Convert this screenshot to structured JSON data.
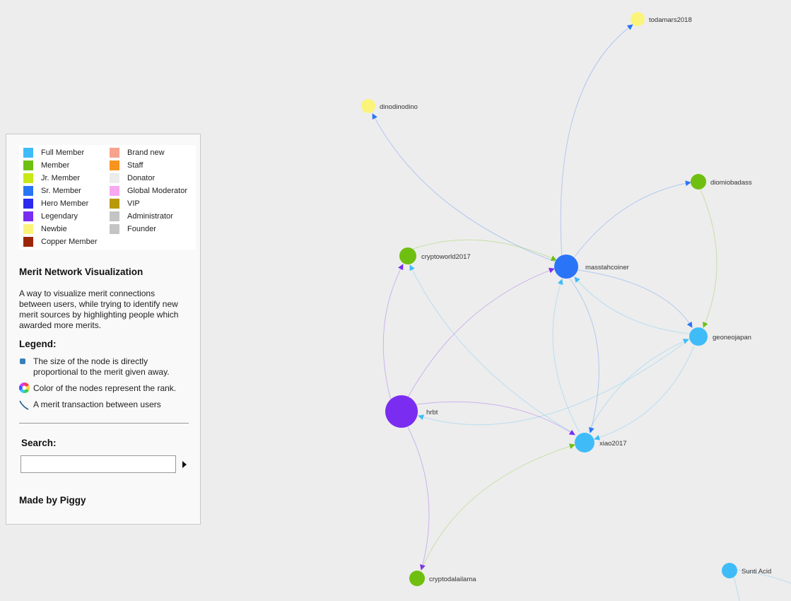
{
  "ranks_left": [
    {
      "name": "Full Member",
      "color": "#3fbcf8"
    },
    {
      "name": "Member",
      "color": "#6fbf10"
    },
    {
      "name": "Jr. Member",
      "color": "#c9e818"
    },
    {
      "name": "Sr. Member",
      "color": "#2a74f8"
    },
    {
      "name": "Hero Member",
      "color": "#2b2bf0"
    },
    {
      "name": "Legendary",
      "color": "#7a2df0"
    },
    {
      "name": "Newbie",
      "color": "#fbf47a"
    },
    {
      "name": "Copper Member",
      "color": "#9c2708"
    }
  ],
  "ranks_right": [
    {
      "name": "Brand new",
      "color": "#f7a28f"
    },
    {
      "name": "Staff",
      "color": "#f7941e"
    },
    {
      "name": "Donator",
      "color": "#ececec"
    },
    {
      "name": "Global Moderator",
      "color": "#f7a8f0"
    },
    {
      "name": "VIP",
      "color": "#b8990a"
    },
    {
      "name": "Administrator",
      "color": "#c4c4c4"
    },
    {
      "name": "Founder",
      "color": "#c4c4c4"
    }
  ],
  "panel": {
    "title": "Merit Network Visualization",
    "description": "A way to visualize merit connections between users, while trying to identify new merit sources by highlighting people which awarded more merits.",
    "legend_heading": "Legend:",
    "legend_size": "The size of the node is directly proportional to the merit given away.",
    "legend_color": "Color of the nodes represent the rank.",
    "legend_edge": "A merit transaction between users",
    "search_heading": "Search:",
    "search_value": "",
    "credit": "Made by Piggy"
  },
  "graph": {
    "nodes": [
      {
        "id": "todamars2018",
        "label": "todamars2018",
        "rank": "Newbie",
        "color": "#fbf47a"
      },
      {
        "id": "dinodinodino",
        "label": "dinodinodino",
        "rank": "Newbie",
        "color": "#fbf47a"
      },
      {
        "id": "diomiobadass",
        "label": "diomiobadass",
        "rank": "Member",
        "color": "#6fbf10"
      },
      {
        "id": "cryptoworld2017",
        "label": "cryptoworld2017",
        "rank": "Member",
        "color": "#6fbf10"
      },
      {
        "id": "masstahcoiner",
        "label": "masstahcoiner",
        "rank": "Sr. Member",
        "color": "#2a74f8"
      },
      {
        "id": "geoneojapan",
        "label": "geoneojapan",
        "rank": "Full Member",
        "color": "#3fbcf8"
      },
      {
        "id": "hrbt",
        "label": "hrbt",
        "rank": "Legendary",
        "color": "#7a2df0"
      },
      {
        "id": "xiao2017",
        "label": "xiao2017",
        "rank": "Full Member",
        "color": "#3fbcf8"
      },
      {
        "id": "cryptodalailama",
        "label": "cryptodalailama",
        "rank": "Member",
        "color": "#6fbf10"
      },
      {
        "id": "sunti",
        "label": "Sunti Acid",
        "rank": "Full Member",
        "color": "#3fbcf8"
      }
    ],
    "edges": [
      {
        "source": "masstahcoiner",
        "target": "todamars2018"
      },
      {
        "source": "masstahcoiner",
        "target": "dinodinodino"
      },
      {
        "source": "masstahcoiner",
        "target": "diomiobadass"
      },
      {
        "source": "masstahcoiner",
        "target": "geoneojapan"
      },
      {
        "source": "masstahcoiner",
        "target": "xiao2017"
      },
      {
        "source": "cryptoworld2017",
        "target": "masstahcoiner"
      },
      {
        "source": "diomiobadass",
        "target": "geoneojapan"
      },
      {
        "source": "geoneojapan",
        "target": "masstahcoiner"
      },
      {
        "source": "geoneojapan",
        "target": "hrbt"
      },
      {
        "source": "geoneojapan",
        "target": "xiao2017"
      },
      {
        "source": "xiao2017",
        "target": "masstahcoiner"
      },
      {
        "source": "xiao2017",
        "target": "geoneojapan"
      },
      {
        "source": "xiao2017",
        "target": "cryptoworld2017"
      },
      {
        "source": "hrbt",
        "target": "masstahcoiner"
      },
      {
        "source": "hrbt",
        "target": "cryptoworld2017"
      },
      {
        "source": "hrbt",
        "target": "xiao2017"
      },
      {
        "source": "hrbt",
        "target": "cryptodalailama"
      },
      {
        "source": "cryptodalailama",
        "target": "xiao2017"
      },
      {
        "source": "sunti",
        "target": "offscreen-1"
      },
      {
        "source": "sunti",
        "target": "offscreen-2"
      }
    ]
  }
}
